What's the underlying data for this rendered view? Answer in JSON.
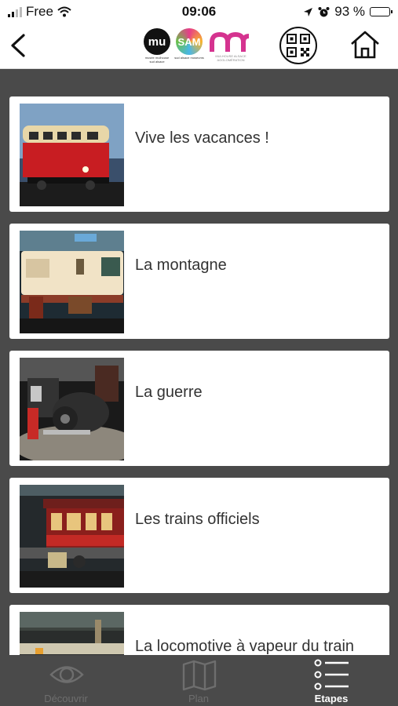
{
  "status_bar": {
    "carrier": "Free",
    "time": "09:06",
    "battery": "93 %",
    "battery_level": 0.93
  },
  "header": {
    "logos": {
      "mu": "mu",
      "sam": "SAM",
      "mu_caption": "musée mulhouse sud alsace",
      "sam_caption": "sud alsace museums",
      "m_caption": "MULHOUSE ALSACE AGGLOMÉRATION"
    }
  },
  "items": [
    {
      "title": "Vive les vacances !"
    },
    {
      "title": "La montagne"
    },
    {
      "title": "La guerre"
    },
    {
      "title": "Les trains officiels"
    },
    {
      "title": "La locomotive à vapeur du train impérial"
    }
  ],
  "tabs": [
    {
      "label": "Découvrir",
      "icon": "eye-icon",
      "active": false
    },
    {
      "label": "Plan",
      "icon": "map-icon",
      "active": false
    },
    {
      "label": "Etapes",
      "icon": "list-icon",
      "active": true
    }
  ],
  "colors": {
    "background": "#4a4a4a",
    "tab_active": "#ffffff",
    "tab_inactive": "#6e6e6e",
    "card": "#ffffff",
    "text": "#333333"
  }
}
